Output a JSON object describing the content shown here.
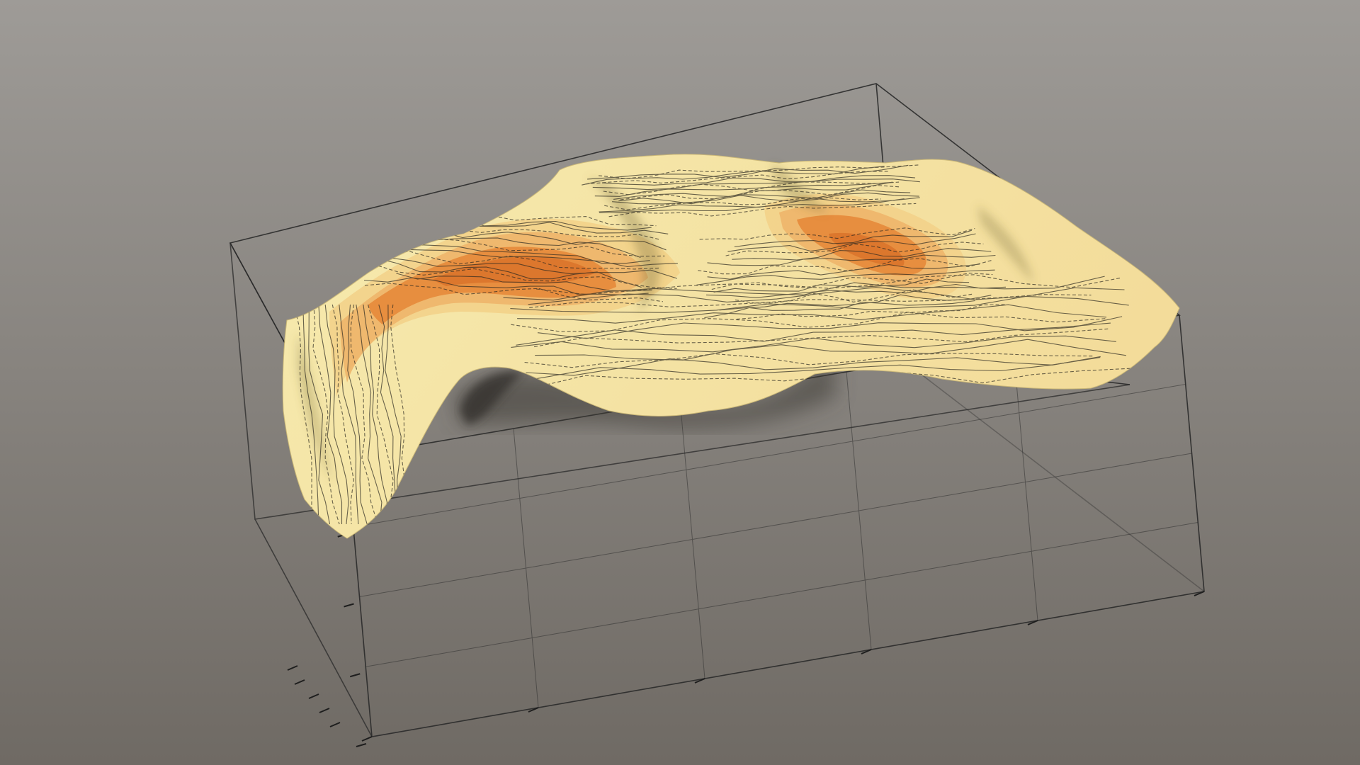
{
  "scene": {
    "background_top": "#9e9b97",
    "background_bottom": "#6f6a64",
    "bounding_box_color": "#2a2a2a",
    "surface_colors": {
      "pale": "#f6eaae",
      "light": "#f3dc9a",
      "mid": "#eeb56a",
      "deep": "#e58a3a",
      "darkest": "#d9732a"
    },
    "contour_color": "#2d2a22",
    "shadow_color": "#3e3a36"
  }
}
